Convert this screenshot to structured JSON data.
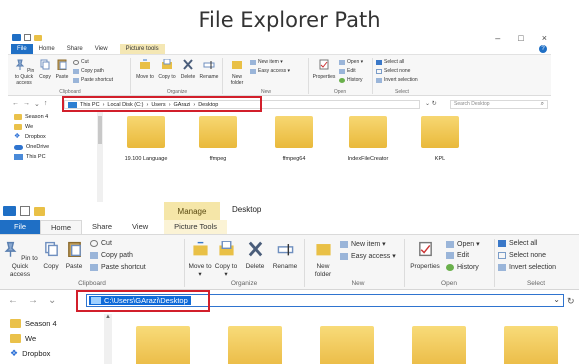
{
  "heading": "File Explorer Path",
  "top": {
    "tabs": [
      "File",
      "Home",
      "Share",
      "View",
      "Picture tools"
    ],
    "window_controls": [
      "–",
      "□",
      "×"
    ],
    "ribbon": {
      "pin": "Pin to Quick access",
      "copy": "Copy",
      "paste": "Paste",
      "cut": "Cut",
      "copy_path": "Copy path",
      "paste_shortcut": "Paste shortcut",
      "move_to": "Move to",
      "copy_to": "Copy to",
      "delete": "Delete",
      "rename": "Rename",
      "new_folder": "New folder",
      "new_item": "New item ▾",
      "easy_access": "Easy access ▾",
      "properties": "Properties",
      "open": "Open ▾",
      "edit": "Edit",
      "history": "History",
      "select_all": "Select all",
      "select_none": "Select none",
      "invert_selection": "Invert selection",
      "groups": {
        "clipboard": "Clipboard",
        "organize": "Organize",
        "new": "New",
        "open": "Open",
        "select": "Select"
      }
    },
    "address": {
      "segments": [
        "This PC",
        "›",
        "Local Disk (C:)",
        "›",
        "Users",
        "›",
        "GArazi",
        "›",
        "Desktop"
      ],
      "search_placeholder": "Search Desktop"
    },
    "nav_pane": [
      "Season 4",
      "We",
      "Dropbox",
      "OneDrive",
      "This PC"
    ],
    "files": [
      "19.100 Language",
      "ffmpeg",
      "ffmpeg64",
      "IndexFileCreator",
      "KPL"
    ]
  },
  "bottom": {
    "manage_tab": "Manage",
    "window_title": "Desktop",
    "tabs": {
      "file": "File",
      "home": "Home",
      "share": "Share",
      "view": "View",
      "picture_tools": "Picture Tools"
    },
    "ribbon": {
      "pin": "Pin to Quick access",
      "copy": "Copy",
      "paste": "Paste",
      "cut": "Cut",
      "copy_path": "Copy path",
      "paste_shortcut": "Paste shortcut",
      "move_to": "Move to ▾",
      "copy_to": "Copy to ▾",
      "delete": "Delete",
      "rename": "Rename",
      "new_folder": "New folder",
      "new_item": "New item ▾",
      "easy_access": "Easy access ▾",
      "properties": "Properties",
      "open": "Open ▾",
      "edit": "Edit",
      "history": "History",
      "select_all": "Select all",
      "select_none": "Select none",
      "invert_selection": "Invert selection",
      "groups": {
        "clipboard": "Clipboard",
        "organize": "Organize",
        "new": "New",
        "open": "Open",
        "select": "Select"
      }
    },
    "address": {
      "path": "C:\\Users\\GArazi\\Desktop"
    },
    "nav_pane": [
      "Season 4",
      "We",
      "Dropbox"
    ]
  },
  "colors": {
    "accent": "#1f6fc5",
    "highlight": "#d21f2b",
    "folder": "#eab942"
  }
}
